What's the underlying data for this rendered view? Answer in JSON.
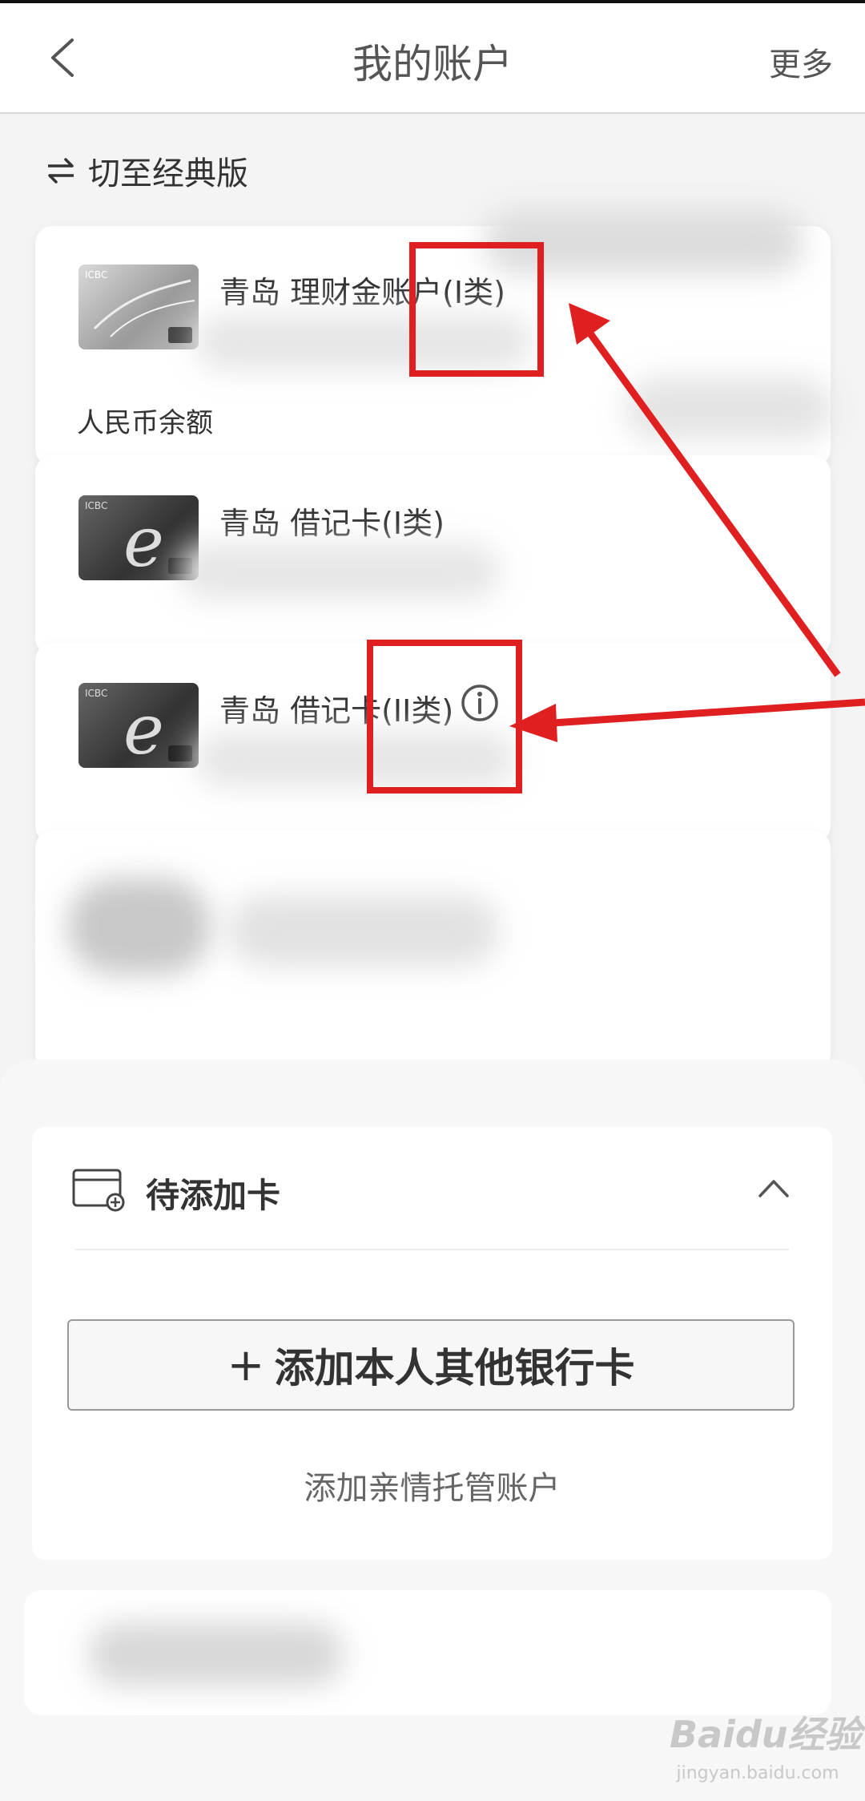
{
  "header": {
    "title": "我的账户",
    "more_label": "更多"
  },
  "switch_label": "切至经典版",
  "accounts": [
    {
      "title": "青岛 理财金账户(I类)"
    },
    {
      "title": "青岛 借记卡(I类)"
    },
    {
      "title": "青岛 借记卡(II类)"
    }
  ],
  "cny_balance_label": "人民币余额",
  "pending": {
    "title": "待添加卡",
    "add_button_label": "添加本人其他银行卡",
    "add_button_plus": "+",
    "family_link": "添加亲情托管账户"
  },
  "card_logo": "ICBC",
  "watermark": {
    "brand": "Bai",
    "brand_suffix": "经验",
    "sub": "jingyan.baidu.com"
  },
  "colors": {
    "annotation_red": "#e02020",
    "background": "#f4f4f4"
  },
  "icons": [
    "chevron-left-icon",
    "swap-arrows-icon",
    "info-icon",
    "card-add-icon",
    "chevron-up-icon"
  ]
}
